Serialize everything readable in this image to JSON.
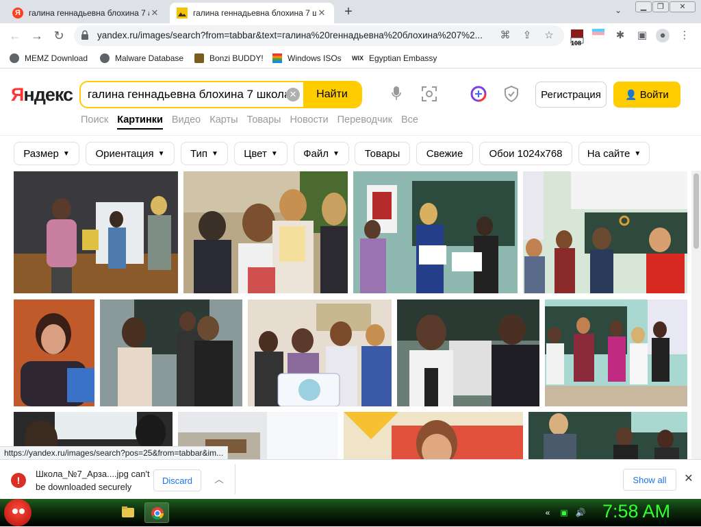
{
  "browser": {
    "tabs": [
      {
        "title": "галина геннадьевна блохина 7 а",
        "active": false,
        "icon": "yandex-icon"
      },
      {
        "title": "галина геннадьевна блохина 7 ш",
        "active": true,
        "icon": "images-icon"
      }
    ],
    "new_tab": "+",
    "url": "yandex.ru/images/search?from=tabbar&text=галина%20геннадьевна%20блохина%207%2...",
    "extension_badge": "108",
    "bookmarks": [
      {
        "label": "MEMZ Download",
        "color": "#5f6368"
      },
      {
        "label": "Malware Database",
        "color": "#5f6368"
      },
      {
        "label": "Bonzi BUDDY!",
        "color": "#7a5c1e"
      },
      {
        "label": "Windows ISOs",
        "color": "#e53935"
      },
      {
        "label": "Egyptian Embassy",
        "color": "#000000"
      }
    ]
  },
  "yandex": {
    "logo": "Яндекс",
    "logo_first": "Я",
    "logo_rest": "ндекс",
    "search_value": "галина геннадьевна блохина 7 школа",
    "find_label": "Найти",
    "register_label": "Регистрация",
    "login_label": "Войти",
    "services": [
      "Поиск",
      "Картинки",
      "Видео",
      "Карты",
      "Товары",
      "Новости",
      "Переводчик",
      "Все"
    ],
    "active_service": "Картинки",
    "filters": [
      {
        "label": "Размер",
        "dropdown": true
      },
      {
        "label": "Ориентация",
        "dropdown": true
      },
      {
        "label": "Тип",
        "dropdown": true
      },
      {
        "label": "Цвет",
        "dropdown": true
      },
      {
        "label": "Файл",
        "dropdown": true
      },
      {
        "label": "Товары",
        "dropdown": false
      },
      {
        "label": "Свежие",
        "dropdown": false
      },
      {
        "label": "Обои 1024x768",
        "dropdown": false
      },
      {
        "label": "На сайте",
        "dropdown": true
      }
    ]
  },
  "status_url": "https://yandex.ru/images/search?pos=25&from=tabbar&im...",
  "download": {
    "filename": "Школа_№7_Арза....jpg can't",
    "message": "be downloaded securely",
    "discard_label": "Discard",
    "show_all_label": "Show all"
  },
  "taskbar": {
    "clock": "7:58 AM"
  },
  "colors": {
    "accent_yellow": "#ffcc00",
    "yandex_red": "#ff3333",
    "clock_green": "#33ff33",
    "link_blue": "#1a73e8"
  }
}
